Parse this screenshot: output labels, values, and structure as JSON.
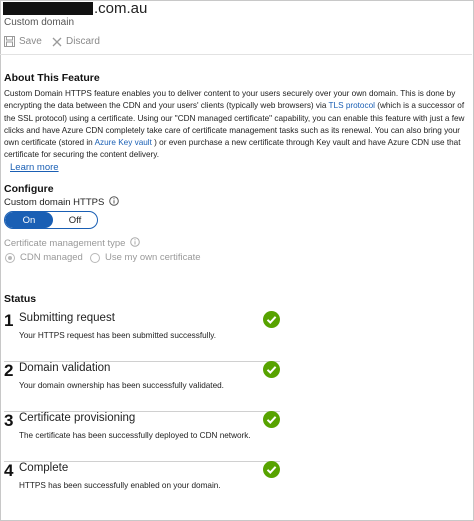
{
  "header": {
    "title_suffix": ".com.au",
    "subtitle": "Custom domain"
  },
  "toolbar": {
    "save_label": "Save",
    "discard_label": "Discard"
  },
  "about": {
    "heading": "About This Feature",
    "text_1": "Custom Domain HTTPS feature enables you to deliver content to your users securely over your own domain. This is done by encrypting the data between the CDN and your users' clients (typically web browsers) via ",
    "tls_link": "TLS protocol",
    "text_2": " (which is a successor of the SSL protocol) using a certificate. Using our \"CDN managed certificate\" capability, you can enable this feature with just a few clicks and have Azure CDN completely take care of certificate management tasks such as its renewal. You can also bring your own certificate (stored in ",
    "keyvault_link": "Azure Key vault",
    "text_3": " ) or even purchase a new certificate through Key vault and have Azure CDN use that certificate for securing the content delivery.",
    "learn_more": "Learn more"
  },
  "configure": {
    "heading": "Configure",
    "https_label": "Custom domain HTTPS",
    "toggle_on": "On",
    "toggle_off": "Off",
    "cert_mgmt_label": "Certificate management type",
    "option_cdn": "CDN managed",
    "option_own": "Use my own certificate"
  },
  "status": {
    "heading": "Status",
    "check_color": "#57a300",
    "steps": [
      {
        "num": "1",
        "title": "Submitting request",
        "desc": "Your HTTPS request has been submitted successfully."
      },
      {
        "num": "2",
        "title": "Domain validation",
        "desc": "Your domain ownership has been successfully validated."
      },
      {
        "num": "3",
        "title": "Certificate provisioning",
        "desc": "The certificate has been successfully deployed to CDN network."
      },
      {
        "num": "4",
        "title": "Complete",
        "desc": "HTTPS has been successfully enabled on your domain."
      }
    ]
  }
}
